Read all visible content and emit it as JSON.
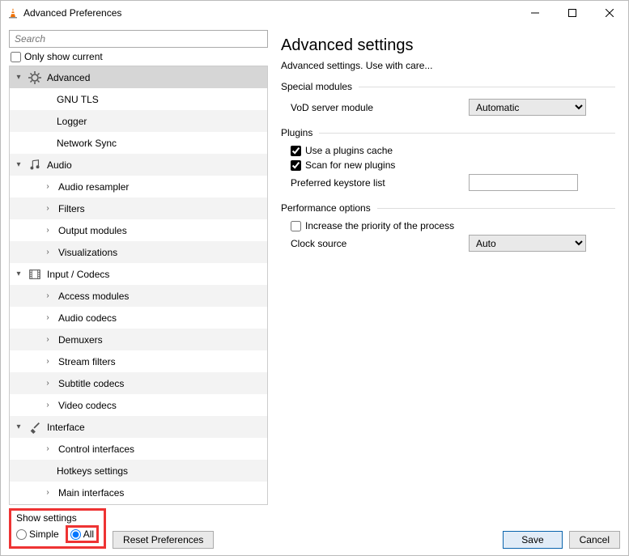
{
  "window": {
    "title": "Advanced Preferences"
  },
  "left": {
    "searchPlaceholder": "Search",
    "onlyShowCurrent": "Only show current",
    "tree": {
      "advanced": "Advanced",
      "gnutls": "GNU TLS",
      "logger": "Logger",
      "networkSync": "Network Sync",
      "audio": "Audio",
      "audioResampler": "Audio resampler",
      "filters": "Filters",
      "outputModules": "Output modules",
      "visualizations": "Visualizations",
      "inputCodecs": "Input / Codecs",
      "accessModules": "Access modules",
      "audioCodecs": "Audio codecs",
      "demuxers": "Demuxers",
      "streamFilters": "Stream filters",
      "subtitleCodecs": "Subtitle codecs",
      "videoCodecs": "Video codecs",
      "interface": "Interface",
      "controlInterfaces": "Control interfaces",
      "hotkeysSettings": "Hotkeys settings",
      "mainInterfaces": "Main interfaces"
    }
  },
  "right": {
    "title": "Advanced settings",
    "subtitle": "Advanced settings. Use with care...",
    "specialModules": {
      "title": "Special modules",
      "vodLabel": "VoD server module",
      "vodValue": "Automatic"
    },
    "plugins": {
      "title": "Plugins",
      "useCache": "Use a plugins cache",
      "scanNew": "Scan for new plugins",
      "keystoreLabel": "Preferred keystore list",
      "keystoreValue": ""
    },
    "performance": {
      "title": "Performance options",
      "increasePriority": "Increase the priority of the process",
      "clockLabel": "Clock source",
      "clockValue": "Auto"
    }
  },
  "bottom": {
    "showSettings": "Show settings",
    "simple": "Simple",
    "all": "All",
    "reset": "Reset Preferences",
    "save": "Save",
    "cancel": "Cancel"
  }
}
